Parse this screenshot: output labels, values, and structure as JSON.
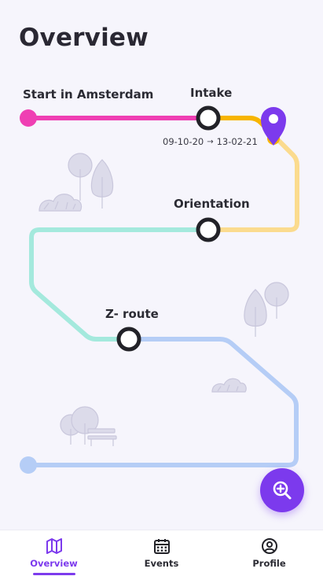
{
  "page": {
    "title": "Overview"
  },
  "route": {
    "stops": {
      "start": "Start in Amsterdam",
      "intake": "Intake",
      "orientation": "Orientation",
      "zroute": "Z- route"
    },
    "intake_dates": {
      "from": "09-10-20",
      "arrow": "→",
      "to": "13-02-21"
    },
    "colors": {
      "pink": "#ef3fb3",
      "yellow": "#f7b500",
      "yellow_light": "#fbdb8e",
      "mint": "#a4e9dd",
      "blue": "#b5cdf6",
      "pin": "#7c3aed"
    },
    "current_location_icon": "map-pin-icon"
  },
  "fab": {
    "icon": "zoom-in-icon"
  },
  "tabbar": {
    "tabs": [
      {
        "label": "Overview",
        "icon": "map-icon",
        "active": true
      },
      {
        "label": "Events",
        "icon": "calendar-icon",
        "active": false
      },
      {
        "label": "Profile",
        "icon": "user-circle-icon",
        "active": false
      }
    ]
  }
}
